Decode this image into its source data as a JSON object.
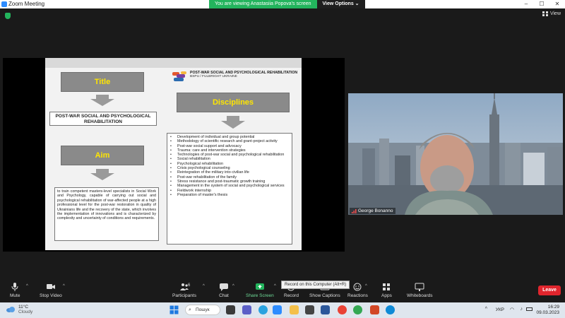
{
  "window": {
    "title": "Zoom Meeting",
    "share_banner": "You are viewing Anastasiia Popova's screen",
    "view_options": "View Options",
    "view_button": "View"
  },
  "slide": {
    "logo_title": "POST-WAR SOCIAL AND PSYCHOLOGICAL REHABILITATION",
    "logo_subtitle": "BSPU / FULBRIGHT UKRAINE",
    "title_label": "Title",
    "program_name": "POST-WAR SOCIAL AND PSYCHOLOGICAL REHABILITATION",
    "aim_label": "Aim",
    "aim_text": "to train competent masters-level specialists in Social Work and Psychology, capable of carrying out social and psychological rehabilitation of war-affected people at a high professional level for the post-war restoration in quality of Ukrainians life and the recovery of the state, which involves the implementation of innovations and is characterized by complexity and uncertainty of conditions and requirements.",
    "disciplines_label": "Disciplines",
    "disciplines": [
      "Development of individual and group potential",
      "Methodology of scientific research and grant-project activity",
      "Post-war social support and advocacy",
      "Trauma: care and intervention strategies",
      "Technologies of post-war social and psychological rehabilitation",
      "Social rehabilitation",
      "Psychological rehabilitation",
      "Crisis psychological counseling",
      "Reintegration of the military into civilian life",
      "Post-war rehabilitation of the family",
      "Stress resistance and post-traumatic growth training",
      "Management in the system of social and psychological services",
      "Fieldwork internship",
      "Preparation of master's thesis"
    ]
  },
  "video": {
    "participant_name": "George Bonanno"
  },
  "toolbar": {
    "mute": "Mute",
    "stop_video": "Stop Video",
    "participants": "Participants",
    "participants_count": "6",
    "chat": "Chat",
    "share_screen": "Share Screen",
    "record": "Record",
    "show_captions": "Show Captions",
    "reactions": "Reactions",
    "apps": "Apps",
    "whiteboards": "Whiteboards",
    "leave": "Leave",
    "record_tooltip": "Record on this Computer (Alt+R)"
  },
  "taskbar": {
    "weather_temp": "11°C",
    "weather_desc": "Cloudy",
    "search_label": "Пошук",
    "language": "УКР",
    "time": "16:29",
    "date": "09.03.2023"
  },
  "colors": {
    "share_green": "#23b45d",
    "slide_box_grey": "#8a8a8a",
    "slide_box_text": "#ffe600",
    "leave_red": "#e0252d"
  }
}
